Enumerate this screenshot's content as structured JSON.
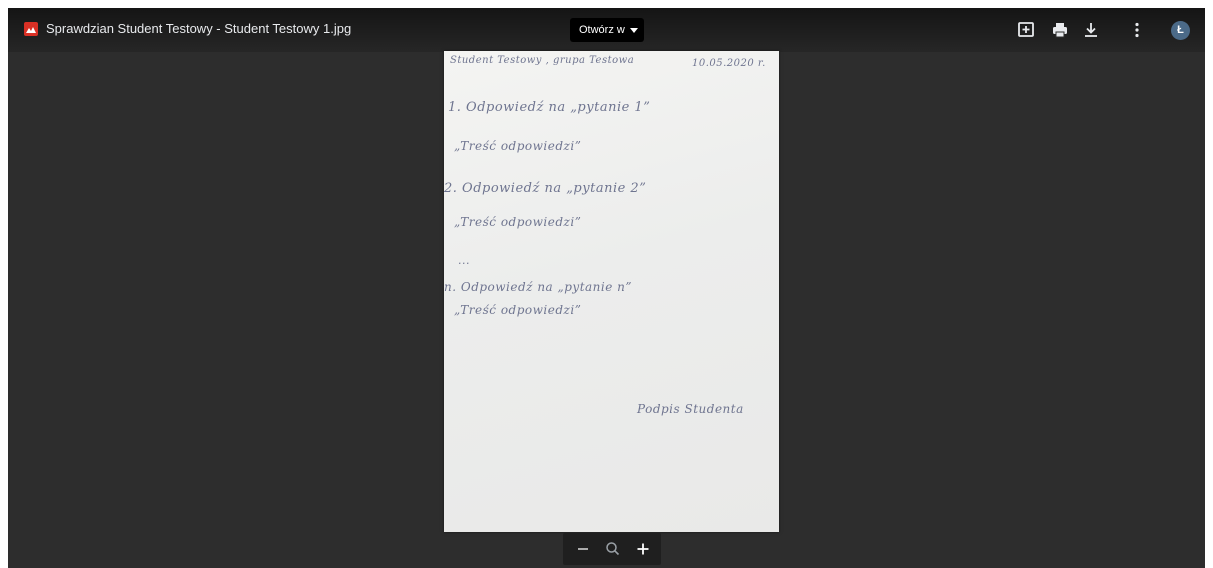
{
  "topbar": {
    "file_title": "Sprawdzian Student Testowy - Student Testowy 1.jpg",
    "open_with_label": "Otwórz w",
    "icons": [
      "add-comment-icon",
      "print-icon",
      "download-icon",
      "more-vert-icon"
    ],
    "avatar_letter": "Ł",
    "avatar_color": "#4b6a88"
  },
  "document": {
    "header_left": "Student Testowy , grupa Testowa",
    "header_date": "10.05.2020 r.",
    "q1_heading": "1. Odpowiedź na „pytanie 1”",
    "q1_answer": "„Treść odpowiedzi”",
    "q2_heading": "2. Odpowiedź na „pytanie 2”",
    "q2_answer": "„Treść odpowiedzi”",
    "ellipsis": "...",
    "qn_heading": "n. Odpowiedź na „pytanie n”",
    "qn_answer": "„Treść odpowiedzi”",
    "signature": "Podpis Studenta"
  },
  "zoombar": {
    "icons": [
      "zoom-out-icon",
      "zoom-reset-icon",
      "zoom-in-icon"
    ]
  },
  "colors": {
    "viewer_bg": "#2d2d2d",
    "file_icon": "#d93025",
    "ink": "#6f7590"
  }
}
